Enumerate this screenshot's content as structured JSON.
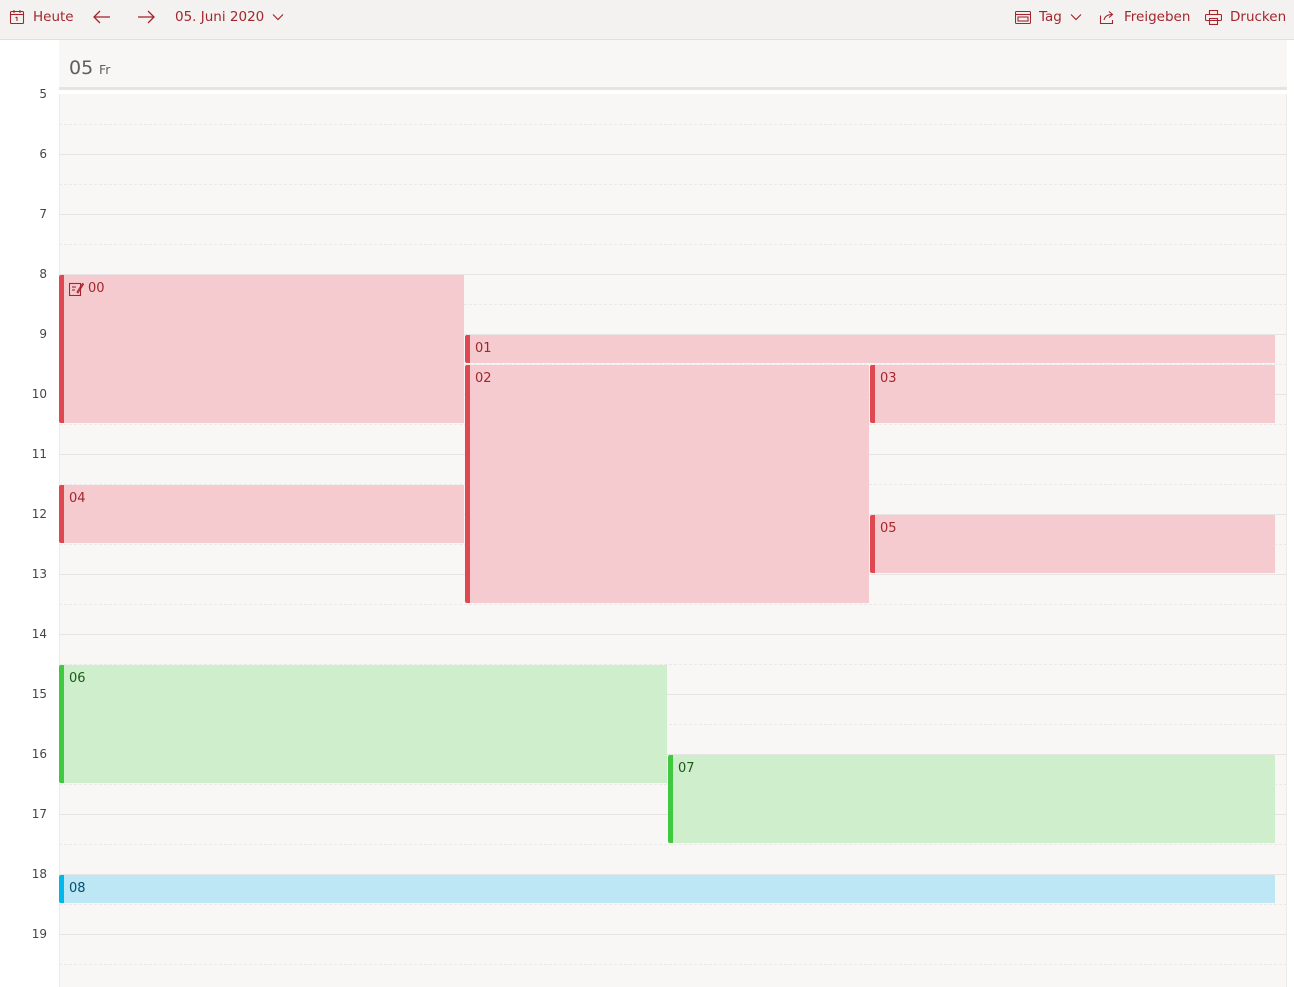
{
  "toolbar": {
    "today_label": "Heute",
    "date_label": "05. Juni 2020",
    "view_label": "Tag",
    "share_label": "Freigeben",
    "print_label": "Drucken"
  },
  "day": {
    "number": "05",
    "weekday": "Fr"
  },
  "hours": [
    "5",
    "6",
    "7",
    "8",
    "9",
    "10",
    "11",
    "12",
    "13",
    "14",
    "15",
    "16",
    "17",
    "18",
    "19"
  ],
  "events": [
    {
      "title": "00",
      "color": "red",
      "icon": "edit-note-icon"
    },
    {
      "title": "01",
      "color": "red"
    },
    {
      "title": "02",
      "color": "red"
    },
    {
      "title": "03",
      "color": "red"
    },
    {
      "title": "04",
      "color": "red"
    },
    {
      "title": "05",
      "color": "red"
    },
    {
      "title": "06",
      "color": "green"
    },
    {
      "title": "07",
      "color": "green"
    },
    {
      "title": "08",
      "color": "blue"
    }
  ],
  "colors": {
    "accent": "#a4262c",
    "red_fill": "#f5cbd0",
    "red_bar": "#e04851",
    "green_fill": "#cfeecb",
    "green_bar": "#3fc93f",
    "blue_fill": "#bee7f6",
    "blue_bar": "#00b7ea"
  }
}
